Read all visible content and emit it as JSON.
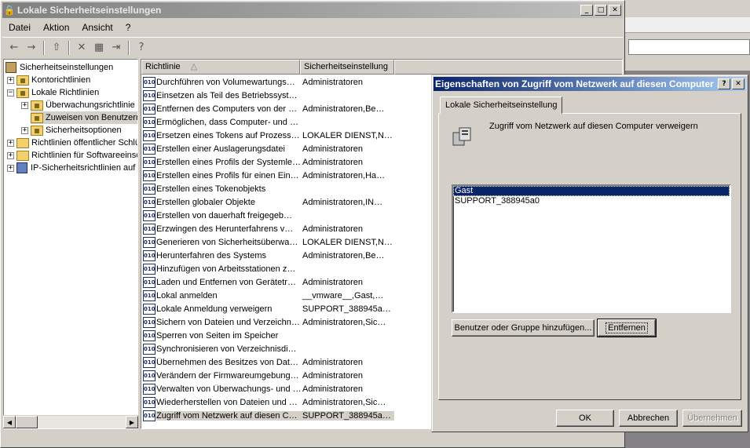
{
  "main_window": {
    "title": "Lokale Sicherheitseinstellungen",
    "menu": [
      "Datei",
      "Aktion",
      "Ansicht",
      "?"
    ]
  },
  "tree": {
    "items": [
      {
        "label": "Sicherheitseinstellungen",
        "level": 0,
        "expander": ""
      },
      {
        "label": "Kontorichtlinien",
        "level": 1,
        "expander": "+"
      },
      {
        "label": "Lokale Richtlinien",
        "level": 1,
        "expander": "−"
      },
      {
        "label": "Überwachungsrichtlinie",
        "level": 2,
        "expander": "+"
      },
      {
        "label": "Zuweisen von Benutzerrechten",
        "level": 2,
        "expander": "",
        "selected": true
      },
      {
        "label": "Sicherheitsoptionen",
        "level": 2,
        "expander": "+"
      },
      {
        "label": "Richtlinien öffentlicher Schlüssel",
        "level": 1,
        "expander": "+"
      },
      {
        "label": "Richtlinien für Softwareeinschränkung",
        "level": 1,
        "expander": "+"
      },
      {
        "label": "IP-Sicherheitsrichtlinien auf Lokaler Computer",
        "level": 1,
        "expander": "+"
      }
    ]
  },
  "list": {
    "columns": [
      "Richtlinie",
      "Sicherheitseinstellung"
    ],
    "rows": [
      {
        "policy": "Durchführen von Volumewartungs…",
        "setting": "Administratoren"
      },
      {
        "policy": "Einsetzen als Teil des Betriebssyst…",
        "setting": ""
      },
      {
        "policy": "Entfernen des Computers von der …",
        "setting": "Administratoren,Be…"
      },
      {
        "policy": "Ermöglichen, dass Computer- und …",
        "setting": ""
      },
      {
        "policy": "Ersetzen eines Tokens auf Prozess…",
        "setting": "LOKALER DIENST,N…"
      },
      {
        "policy": "Erstellen einer Auslagerungsdatei",
        "setting": "Administratoren"
      },
      {
        "policy": "Erstellen eines Profils der Systemle…",
        "setting": "Administratoren"
      },
      {
        "policy": "Erstellen eines Profils für einen Ein…",
        "setting": "Administratoren,Ha…"
      },
      {
        "policy": "Erstellen eines Tokenobjekts",
        "setting": ""
      },
      {
        "policy": "Erstellen globaler Objekte",
        "setting": "Administratoren,IN…"
      },
      {
        "policy": "Erstellen von dauerhaft freigegeb…",
        "setting": ""
      },
      {
        "policy": "Erzwingen des Herunterfahrens v…",
        "setting": "Administratoren"
      },
      {
        "policy": "Generieren von Sicherheitsüberwa…",
        "setting": "LOKALER DIENST,N…"
      },
      {
        "policy": "Herunterfahren des Systems",
        "setting": "Administratoren,Be…"
      },
      {
        "policy": "Hinzufügen von Arbeitsstationen z…",
        "setting": ""
      },
      {
        "policy": "Laden und Entfernen von Gerätetr…",
        "setting": "Administratoren"
      },
      {
        "policy": "Lokal anmelden",
        "setting": "__vmware__,Gast,…"
      },
      {
        "policy": "Lokale Anmeldung verweigern",
        "setting": "SUPPORT_388945a…"
      },
      {
        "policy": "Sichern von Dateien und Verzeichn…",
        "setting": "Administratoren,Sic…"
      },
      {
        "policy": "Sperren von Seiten im Speicher",
        "setting": ""
      },
      {
        "policy": "Synchronisieren von Verzeichnisdi…",
        "setting": ""
      },
      {
        "policy": "Übernehmen des Besitzes von Dat…",
        "setting": "Administratoren"
      },
      {
        "policy": "Verändern der Firmwareumgebung…",
        "setting": "Administratoren"
      },
      {
        "policy": "Verwalten von Überwachungs- und …",
        "setting": "Administratoren"
      },
      {
        "policy": "Wiederherstellen von Dateien und …",
        "setting": "Administratoren,Sic…"
      },
      {
        "policy": "Zugriff vom Netzwerk auf diesen C…",
        "setting": "SUPPORT_388945a…",
        "selected": true
      }
    ]
  },
  "dialog": {
    "title": "Eigenschaften von Zugriff vom Netzwerk auf diesen Computer …",
    "tab": "Lokale Sicherheitseinstellung",
    "policy_name": "Zugriff vom Netzwerk auf diesen Computer verweigern",
    "users": [
      "Gast",
      "SUPPORT_388945a0"
    ],
    "add_button": "Benutzer oder Gruppe hinzufügen...",
    "remove_button": "Entfernen",
    "ok": "OK",
    "cancel": "Abbrechen",
    "apply": "Übernehmen"
  }
}
